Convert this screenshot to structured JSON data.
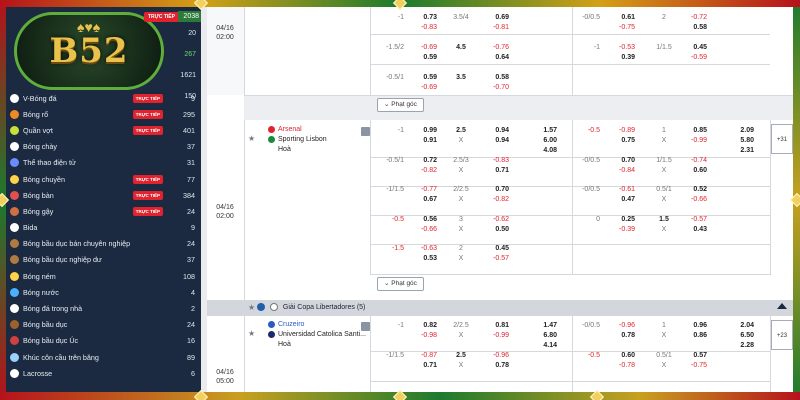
{
  "logo": {
    "text": "B52",
    "badge": "TRỰC TIẾP",
    "count": "2038"
  },
  "top_counts": [
    "20",
    "267",
    "1621",
    "150"
  ],
  "sports": [
    {
      "name": "V-Bóng đá",
      "live": true,
      "count": "9",
      "icon": "soccer-icon",
      "color": "#ffffff"
    },
    {
      "name": "Bóng rổ",
      "live": true,
      "count": "295",
      "icon": "basketball-icon",
      "color": "#f08a24"
    },
    {
      "name": "Quần vợt",
      "live": true,
      "count": "401",
      "icon": "tennis-icon",
      "color": "#c8e03a"
    },
    {
      "name": "Bóng chày",
      "live": false,
      "count": "37",
      "icon": "baseball-icon",
      "color": "#ffffff"
    },
    {
      "name": "Thể thao điện tử",
      "live": false,
      "count": "31",
      "icon": "esports-icon",
      "color": "#6a8cff"
    },
    {
      "name": "Bóng chuyền",
      "live": true,
      "count": "77",
      "icon": "volleyball-icon",
      "color": "#ffd24a"
    },
    {
      "name": "Bóng bàn",
      "live": true,
      "count": "384",
      "icon": "table-tennis-icon",
      "color": "#e05050"
    },
    {
      "name": "Bóng gậy",
      "live": true,
      "count": "24",
      "icon": "cricket-icon",
      "color": "#d07040"
    },
    {
      "name": "Bida",
      "live": false,
      "count": "9",
      "icon": "billiards-icon",
      "color": "#ffffff"
    },
    {
      "name": "Bóng bầu dục bán chuyên nghiệp",
      "live": false,
      "count": "24",
      "icon": "rugby-league-icon",
      "color": "#b07a40"
    },
    {
      "name": "Bóng bầu dục nghiệp dư",
      "live": false,
      "count": "37",
      "icon": "rugby-union-icon",
      "color": "#b07a40"
    },
    {
      "name": "Bóng ném",
      "live": false,
      "count": "108",
      "icon": "handball-icon",
      "color": "#ffd24a"
    },
    {
      "name": "Bóng nước",
      "live": false,
      "count": "4",
      "icon": "water-polo-icon",
      "color": "#4ab0ff"
    },
    {
      "name": "Bóng đá trong nhà",
      "live": false,
      "count": "2",
      "icon": "futsal-icon",
      "color": "#ffffff"
    },
    {
      "name": "Bóng bầu dục",
      "live": false,
      "count": "24",
      "icon": "american-football-icon",
      "color": "#a0602a"
    },
    {
      "name": "Bóng bầu dục Úc",
      "live": false,
      "count": "16",
      "icon": "aussie-rules-icon",
      "color": "#d04040"
    },
    {
      "name": "Khúc côn cầu trên băng",
      "live": false,
      "count": "89",
      "icon": "ice-hockey-icon",
      "color": "#9ad0ff"
    },
    {
      "name": "Lacrosse",
      "live": false,
      "count": "6",
      "icon": "lacrosse-icon",
      "color": "#ffffff"
    }
  ],
  "match1": {
    "date": "04/16",
    "time": "02:00",
    "rows": [
      {
        "h1": "-1",
        "o1": [
          "0.73",
          "-0.83"
        ],
        "g1": "3.5/4",
        "p1": [
          "0.69",
          "-0.81"
        ],
        "h2": "-0/0.5",
        "o2": [
          "0.61",
          "-0.75"
        ],
        "g2": "2",
        "p2": [
          "-0.72",
          "0.58"
        ]
      },
      {
        "h1": "-1.5/2",
        "o1": [
          "-0.69",
          "0.59"
        ],
        "g1": "4.5",
        "p1": [
          "-0.76",
          "0.64"
        ],
        "h2": "-1",
        "o2": [
          "-0.53",
          "0.39"
        ],
        "g2": "1/1.5",
        "p2": [
          "0.45",
          "-0.59"
        ]
      },
      {
        "h1": "-0.5/1",
        "o1": [
          "0.59",
          "-0.69"
        ],
        "g1": "3.5",
        "p1": [
          "0.58",
          "-0.70"
        ],
        "h2": "",
        "o2": [
          "",
          ""
        ],
        "g2": "",
        "p2": [
          "",
          ""
        ]
      }
    ],
    "corner_btn": "Phạt góc"
  },
  "match2": {
    "date": "04/16",
    "time": "02:00",
    "home": "Arsenal",
    "away": "Sporting Lisbon",
    "draw": "Hoà",
    "x12": [
      "1.57",
      "6.00",
      "4.08"
    ],
    "x12b": [
      "2.09",
      "5.80",
      "2.31"
    ],
    "more": "+31",
    "rows": [
      {
        "h1": "-1",
        "o1": [
          "0.99",
          "0.91"
        ],
        "g1": "2.5",
        "gx": "X",
        "p1": [
          "0.94",
          "0.94"
        ],
        "h2": "-0.5",
        "o2": [
          "-0.89",
          "0.75"
        ],
        "g2": "1",
        "g2x": "X",
        "p2": [
          "0.85",
          "-0.99"
        ]
      },
      {
        "h1": "-0.5/1",
        "o1": [
          "0.72",
          "-0.82"
        ],
        "g1": "2.5/3",
        "gx": "X",
        "p1": [
          "-0.83",
          "0.71"
        ],
        "h2": "-0/0.5",
        "o2": [
          "0.70",
          "-0.84"
        ],
        "g2": "1/1.5",
        "g2x": "X",
        "p2": [
          "-0.74",
          "0.60"
        ]
      },
      {
        "h1": "-1/1.5",
        "o1": [
          "-0.77",
          "0.67"
        ],
        "g1": "2/2.5",
        "gx": "X",
        "p1": [
          "0.70",
          "-0.82"
        ],
        "h2": "-0/0.5",
        "o2": [
          "-0.61",
          "0.47"
        ],
        "g2": "0.5/1",
        "g2x": "X",
        "p2": [
          "0.52",
          "-0.66"
        ]
      },
      {
        "h1": "-0.5",
        "o1": [
          "0.56",
          "-0.66"
        ],
        "g1": "3",
        "gx": "X",
        "p1": [
          "-0.62",
          "0.50"
        ],
        "h2": "0",
        "o2": [
          "0.25",
          "-0.39"
        ],
        "g2": "1.5",
        "g2x": "X",
        "p2": [
          "-0.57",
          "0.43"
        ]
      },
      {
        "h1": "-1.5",
        "o1": [
          "-0.63",
          "0.53"
        ],
        "g1": "2",
        "gx": "X",
        "p1": [
          "0.45",
          "-0.57"
        ],
        "h2": "",
        "o2": [
          "",
          ""
        ],
        "g2": "",
        "g2x": "",
        "p2": [
          "",
          ""
        ]
      }
    ],
    "corner_btn": "Phạt góc"
  },
  "league": {
    "name": "Giải Copa Libertadores (5)"
  },
  "match3": {
    "date": "04/16",
    "time": "05:00",
    "home": "Cruzeiro",
    "away": "Universidad Catolica Santi...",
    "draw": "Hoà",
    "x12": [
      "1.47",
      "6.80",
      "4.14"
    ],
    "x12b": [
      "2.04",
      "6.50",
      "2.28"
    ],
    "more": "+23",
    "rows": [
      {
        "h1": "-1",
        "o1": [
          "0.82",
          "-0.98"
        ],
        "g1": "2/2.5",
        "gx": "X",
        "p1": [
          "0.81",
          "-0.99"
        ],
        "h2": "-0/0.5",
        "o2": [
          "-0.96",
          "0.78"
        ],
        "g2": "1",
        "g2x": "X",
        "p2": [
          "0.96",
          "0.86"
        ]
      },
      {
        "h1": "-1/1.5",
        "o1": [
          "-0.87",
          "0.71"
        ],
        "g1": "2.5",
        "gx": "X",
        "p1": [
          "-0.96",
          "0.78"
        ],
        "h2": "-0.5",
        "o2": [
          "0.60",
          "-0.78"
        ],
        "g2": "0.5/1",
        "g2x": "X",
        "p2": [
          "0.57",
          "-0.75"
        ]
      }
    ]
  }
}
